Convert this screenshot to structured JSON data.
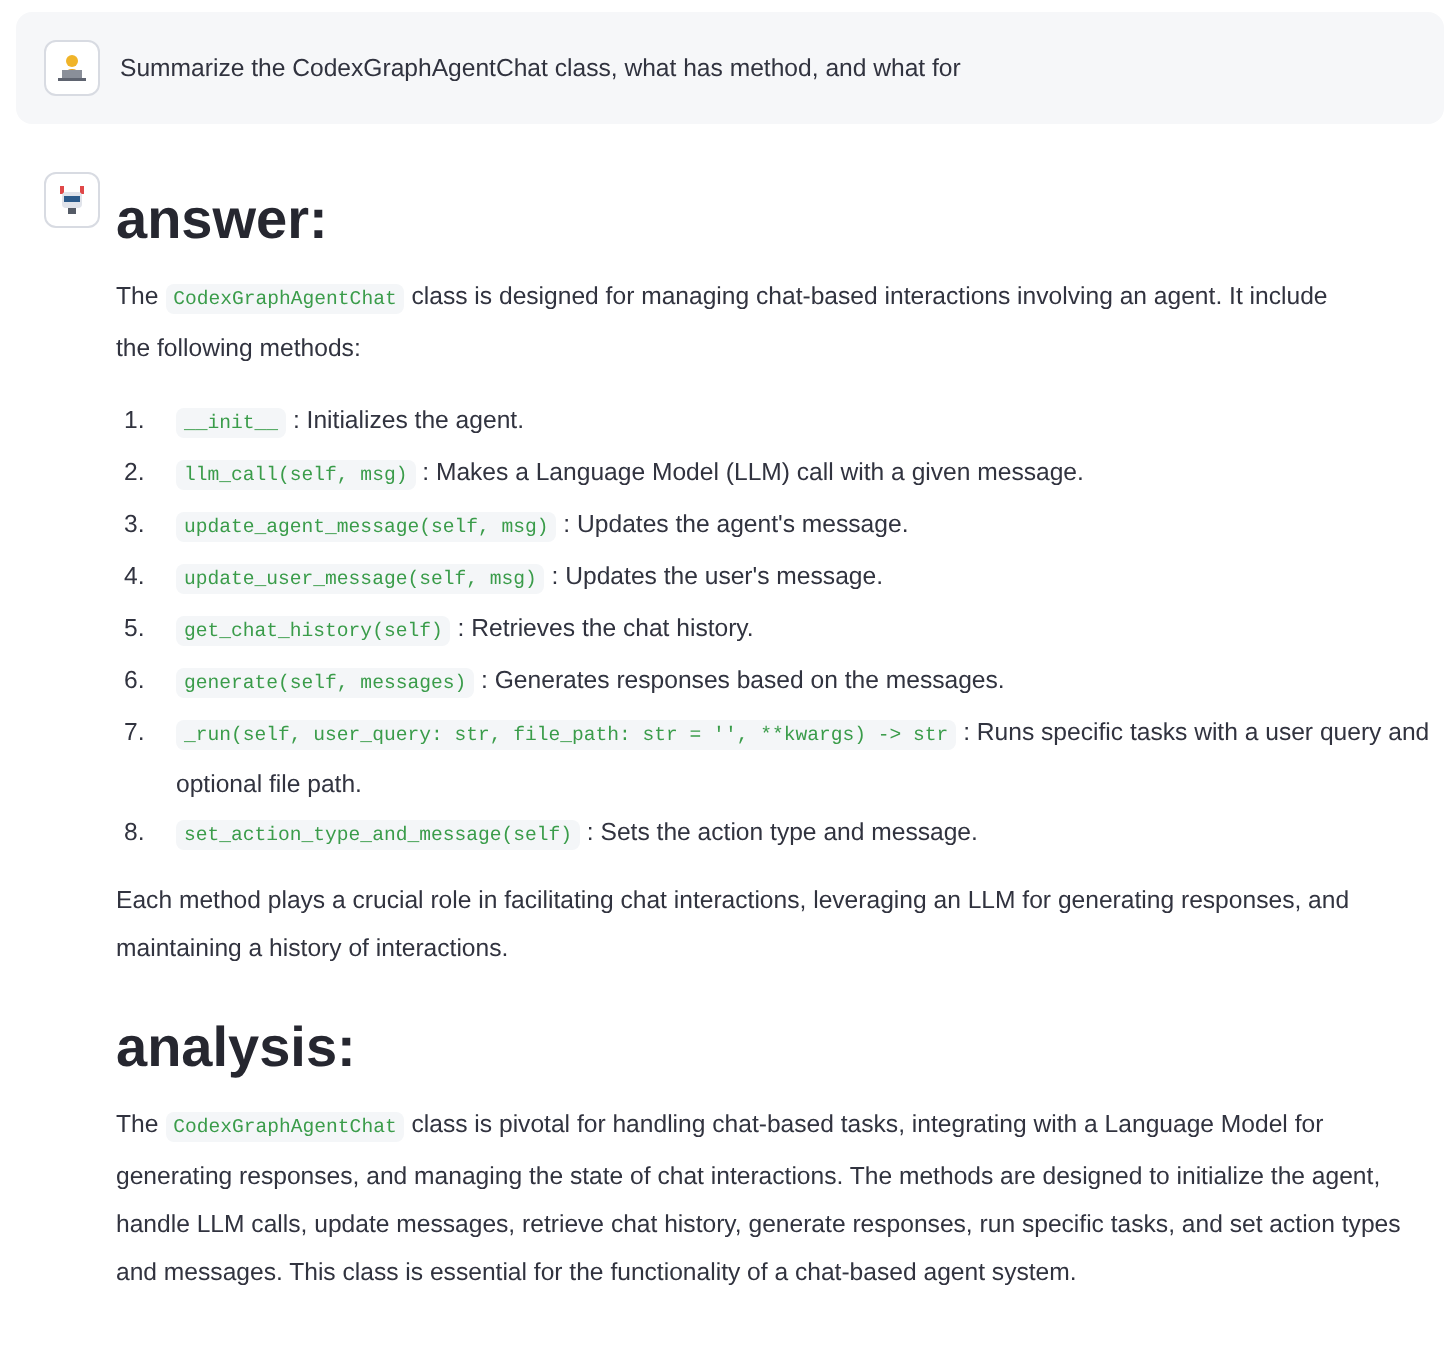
{
  "user_message": {
    "text": "Summarize the CodexGraphAgentChat class, what has method, and what for"
  },
  "reply": {
    "sections": [
      {
        "heading": "answer:",
        "blocks": [
          {
            "kind": "paragraph",
            "parts": [
              {
                "kind": "text",
                "text": "The"
              },
              {
                "kind": "code",
                "text": "CodexGraphAgentChat"
              },
              {
                "kind": "text",
                "text": "class is designed for managing chat-based interactions involving an agent. It include"
              },
              {
                "kind": "break"
              },
              {
                "kind": "text",
                "text": "the following methods:"
              }
            ]
          },
          {
            "kind": "list",
            "items": [
              {
                "number": "1.",
                "code": "__init__",
                "text": ": Initializes the agent."
              },
              {
                "number": "2.",
                "code": "llm_call(self, msg)",
                "text": ": Makes a Language Model (LLM) call with a given message."
              },
              {
                "number": "3.",
                "code": "update_agent_message(self, msg)",
                "text": ": Updates the agent's message."
              },
              {
                "number": "4.",
                "code": "update_user_message(self, msg)",
                "text": ": Updates the user's message."
              },
              {
                "number": "5.",
                "code": "get_chat_history(self)",
                "text": ": Retrieves the chat history."
              },
              {
                "number": "6.",
                "code": "generate(self, messages)",
                "text": ": Generates responses based on the messages."
              },
              {
                "number": "7.",
                "code": "_run(self, user_query: str, file_path: str = '', **kwargs) -> str",
                "text": ": Runs specific tasks with a user query and optional file path."
              },
              {
                "number": "8.",
                "code": "set_action_type_and_message(self)",
                "text": ": Sets the action type and message."
              }
            ]
          },
          {
            "kind": "paragraph",
            "parts": [
              {
                "kind": "text",
                "text": "Each method plays a crucial role in facilitating chat interactions, leveraging an LLM for generating responses, and maintaining a history of interactions."
              }
            ]
          }
        ]
      },
      {
        "heading": "analysis:",
        "blocks": [
          {
            "kind": "paragraph",
            "parts": [
              {
                "kind": "text",
                "text": "The"
              },
              {
                "kind": "code",
                "text": "CodexGraphAgentChat"
              },
              {
                "kind": "text",
                "text": "class is pivotal for handling chat-based tasks, integrating with a Language Model for generating responses, and managing the state of chat interactions. The methods are designed to initialize the agent, handle LLM calls, update messages, retrieve chat history, generate responses, run specific tasks, and set action types and messages. This class is essential for the functionality of a chat-based agent system."
              }
            ]
          }
        ]
      }
    ]
  }
}
